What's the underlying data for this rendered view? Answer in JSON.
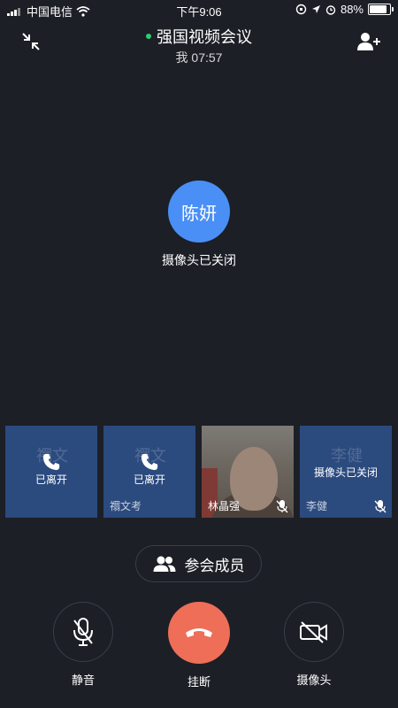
{
  "status_bar": {
    "carrier": "中国电信",
    "time": "下午9:06",
    "battery": "88%",
    "battery_level": 0.88
  },
  "header": {
    "title": "强国视频会议",
    "subtitle": "我 07:57"
  },
  "main_speaker": {
    "avatar_text": "陈妍",
    "status": "摄像头已关闭"
  },
  "tiles": [
    {
      "name": "",
      "status": "已离开",
      "watermark": "禤文"
    },
    {
      "name": "禤文考",
      "status": "已离开",
      "watermark": "禤文"
    },
    {
      "name": "林晶强",
      "status": ""
    },
    {
      "name": "李健",
      "status": "摄像头已关闭",
      "watermark": "李健"
    }
  ],
  "members_button": "参会成员",
  "controls": {
    "mute": "静音",
    "hangup": "挂断",
    "camera": "摄像头"
  },
  "colors": {
    "background": "#1c1f26",
    "avatar": "#4a8ff5",
    "tile": "#2b4a7e",
    "hangup": "#ee6e57",
    "online_dot": "#2ecc71"
  }
}
